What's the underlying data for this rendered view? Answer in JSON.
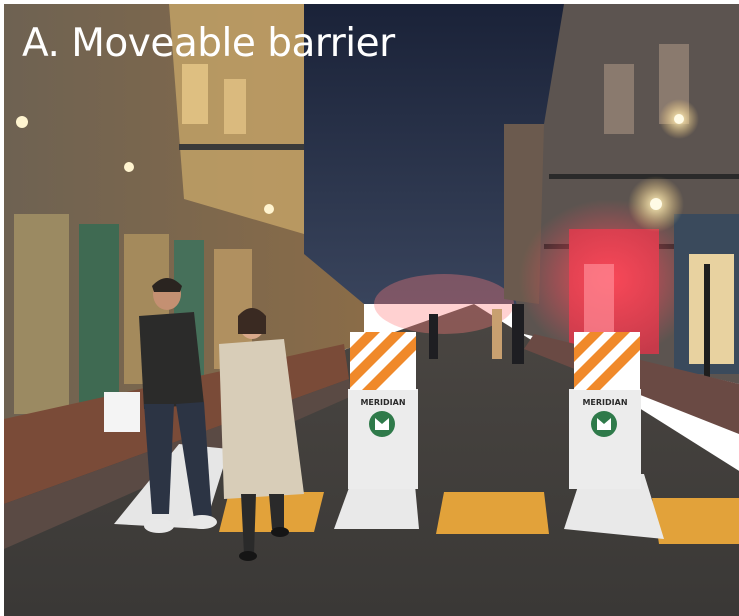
{
  "caption": "A. Moveable barrier",
  "barriers": [
    {
      "brand_label": "MERIDIAN"
    },
    {
      "brand_label": "MERIDIAN"
    }
  ]
}
